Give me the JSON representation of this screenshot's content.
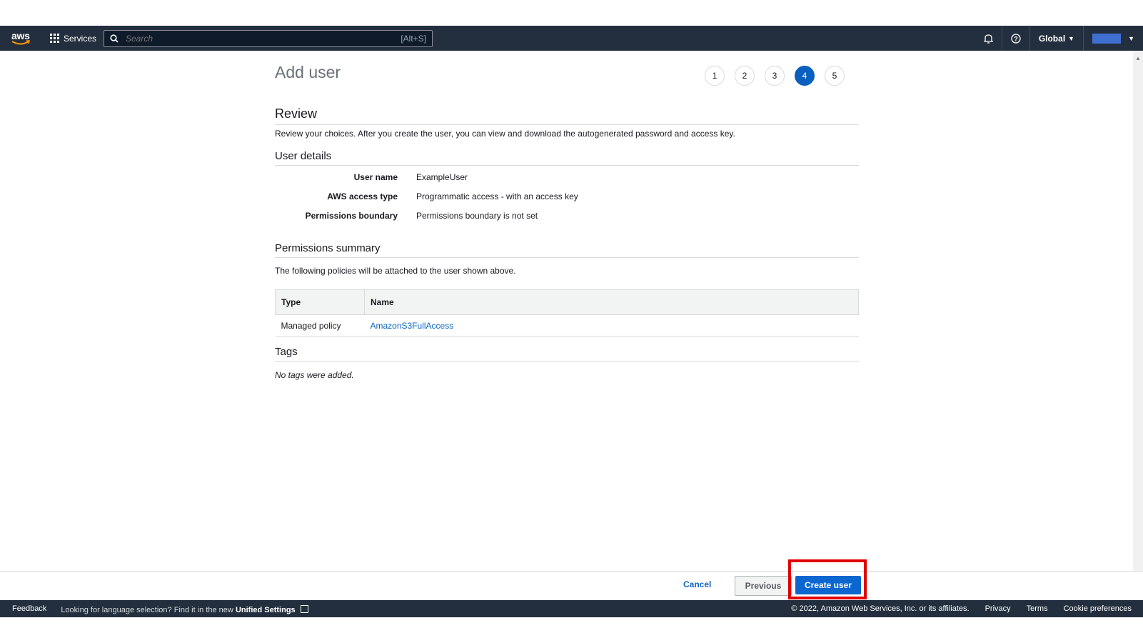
{
  "header": {
    "logo": "aws",
    "services_label": "Services",
    "search_placeholder": "Search",
    "search_shortcut": "[Alt+S]",
    "region_label": "Global"
  },
  "page": {
    "title": "Add user",
    "steps": [
      "1",
      "2",
      "3",
      "4",
      "5"
    ],
    "active_step": 4
  },
  "review": {
    "heading": "Review",
    "description": "Review your choices. After you create the user, you can view and download the autogenerated password and access key."
  },
  "user_details": {
    "heading": "User details",
    "rows": [
      {
        "label": "User name",
        "value": "ExampleUser"
      },
      {
        "label": "AWS access type",
        "value": "Programmatic access - with an access key"
      },
      {
        "label": "Permissions boundary",
        "value": "Permissions boundary is not set"
      }
    ]
  },
  "permissions": {
    "heading": "Permissions summary",
    "description": "The following policies will be attached to the user shown above.",
    "columns": [
      "Type",
      "Name"
    ],
    "rows": [
      {
        "type": "Managed policy",
        "name": "AmazonS3FullAccess"
      }
    ]
  },
  "tags": {
    "heading": "Tags",
    "empty_text": "No tags were added."
  },
  "actions": {
    "cancel": "Cancel",
    "previous": "Previous",
    "create": "Create user"
  },
  "footer": {
    "feedback": "Feedback",
    "language_text": "Looking for language selection? Find it in the new",
    "unified_settings": "Unified Settings",
    "copyright": "© 2022, Amazon Web Services, Inc. or its affiliates.",
    "privacy": "Privacy",
    "terms": "Terms",
    "cookies": "Cookie preferences"
  },
  "colors": {
    "nav_bg": "#232f3e",
    "primary": "#0b66d0",
    "highlight": "#e00000",
    "link": "#0b66c2"
  }
}
